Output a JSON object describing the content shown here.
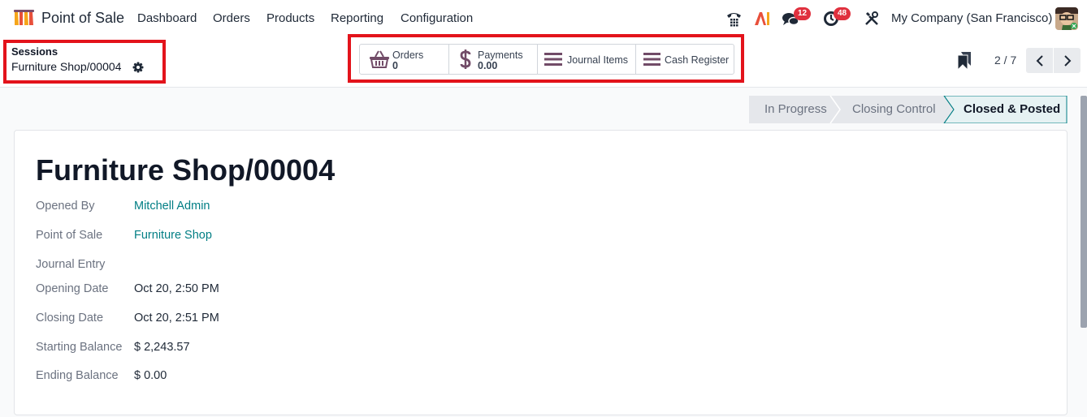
{
  "navbar": {
    "app_name": "Point of Sale",
    "menu": [
      "Dashboard",
      "Orders",
      "Products",
      "Reporting",
      "Configuration"
    ],
    "icons": [
      "phone-icon",
      "ai-icon",
      "chat-icon",
      "activity-clock-icon",
      "tools-icon"
    ],
    "chat_badge": "12",
    "activity_badge": "48",
    "company": "My Company (San Francisco)"
  },
  "breadcrumb": {
    "parent": "Sessions",
    "current": "Furniture Shop/00004"
  },
  "smart_buttons": {
    "orders": {
      "label": "Orders",
      "value": "0"
    },
    "payments": {
      "label": "Payments",
      "value": "0.00"
    },
    "journal_items": {
      "label": "Journal Items"
    },
    "cash_register": {
      "label": "Cash Register"
    }
  },
  "pager": {
    "value": "2 / 7"
  },
  "status": {
    "stages": [
      "In Progress",
      "Closing Control",
      "Closed & Posted"
    ],
    "current": "Closed & Posted"
  },
  "record": {
    "title": "Furniture Shop/00004",
    "fields": {
      "opened_by": {
        "label": "Opened By",
        "value": "Mitchell Admin"
      },
      "point_of_sale": {
        "label": "Point of Sale",
        "value": "Furniture Shop"
      },
      "journal_entry": {
        "label": "Journal Entry",
        "value": ""
      },
      "opening_date": {
        "label": "Opening Date",
        "value": "Oct 20, 2:50 PM"
      },
      "closing_date": {
        "label": "Closing Date",
        "value": "Oct 20, 2:51 PM"
      },
      "starting_balance": {
        "label": "Starting Balance",
        "value": "$ 2,243.57"
      },
      "ending_balance": {
        "label": "Ending Balance",
        "value": "$ 0.00"
      }
    }
  },
  "colors": {
    "link": "#017e84",
    "highlight": "#e3131b",
    "badge": "#e0303e",
    "smart_icon": "#714b67"
  }
}
